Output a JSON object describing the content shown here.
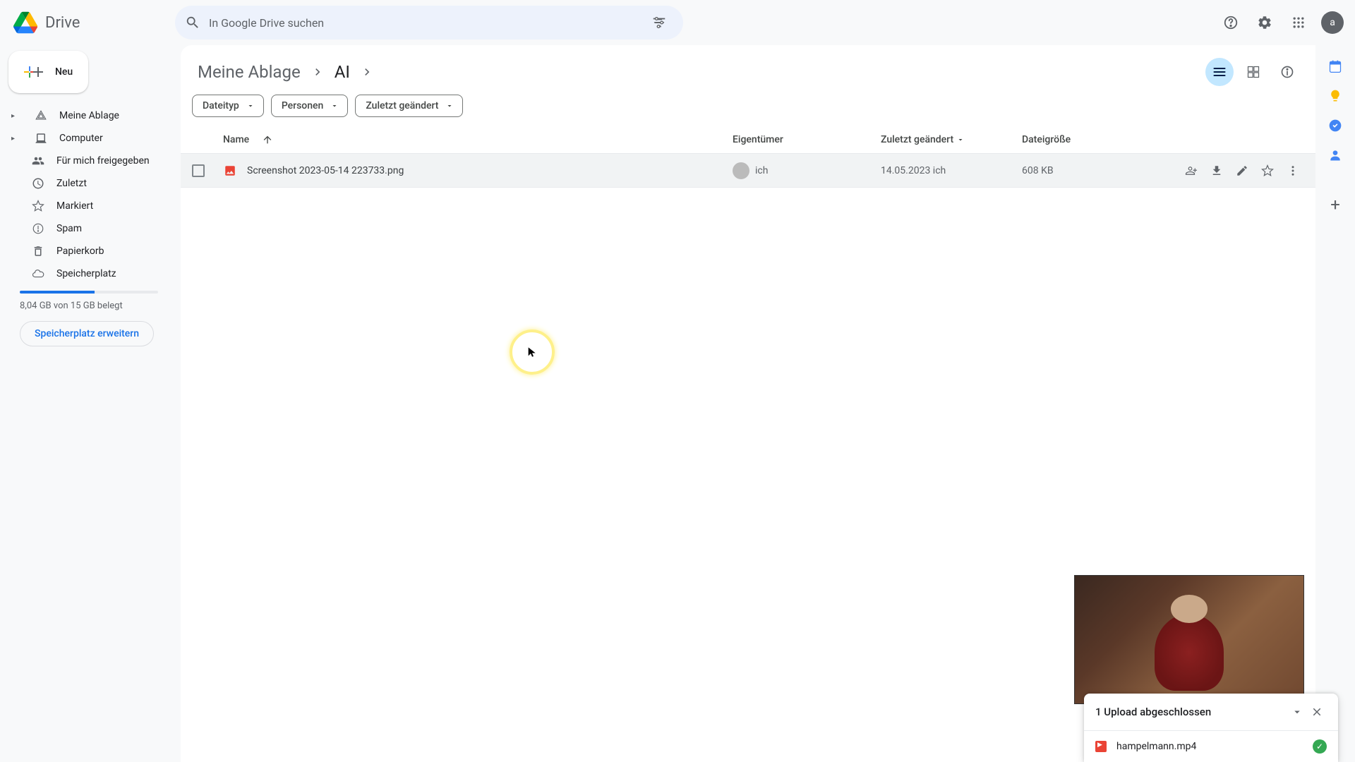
{
  "app": {
    "name": "Drive"
  },
  "search": {
    "placeholder": "In Google Drive suchen"
  },
  "new_button": "Neu",
  "avatar_letter": "a",
  "sidebar": {
    "items": [
      {
        "label": "Meine Ablage"
      },
      {
        "label": "Computer"
      },
      {
        "label": "Für mich freigegeben"
      },
      {
        "label": "Zuletzt"
      },
      {
        "label": "Markiert"
      },
      {
        "label": "Spam"
      },
      {
        "label": "Papierkorb"
      },
      {
        "label": "Speicherplatz"
      }
    ],
    "storage": {
      "text": "8,04 GB von 15 GB belegt",
      "percent": 54,
      "button": "Speicherplatz erweitern"
    }
  },
  "breadcrumb": [
    {
      "label": "Meine Ablage"
    },
    {
      "label": "AI"
    }
  ],
  "filters": [
    {
      "label": "Dateityp"
    },
    {
      "label": "Personen"
    },
    {
      "label": "Zuletzt geändert"
    }
  ],
  "columns": {
    "name": "Name",
    "owner": "Eigentümer",
    "modified": "Zuletzt geändert",
    "size": "Dateigröße"
  },
  "rows": [
    {
      "name": "Screenshot 2023-05-14 223733.png",
      "owner": "ich",
      "modified": "14.05.2023 ich",
      "size": "608 KB"
    }
  ],
  "upload": {
    "title": "1 Upload abgeschlossen",
    "file": "hampelmann.mp4"
  }
}
